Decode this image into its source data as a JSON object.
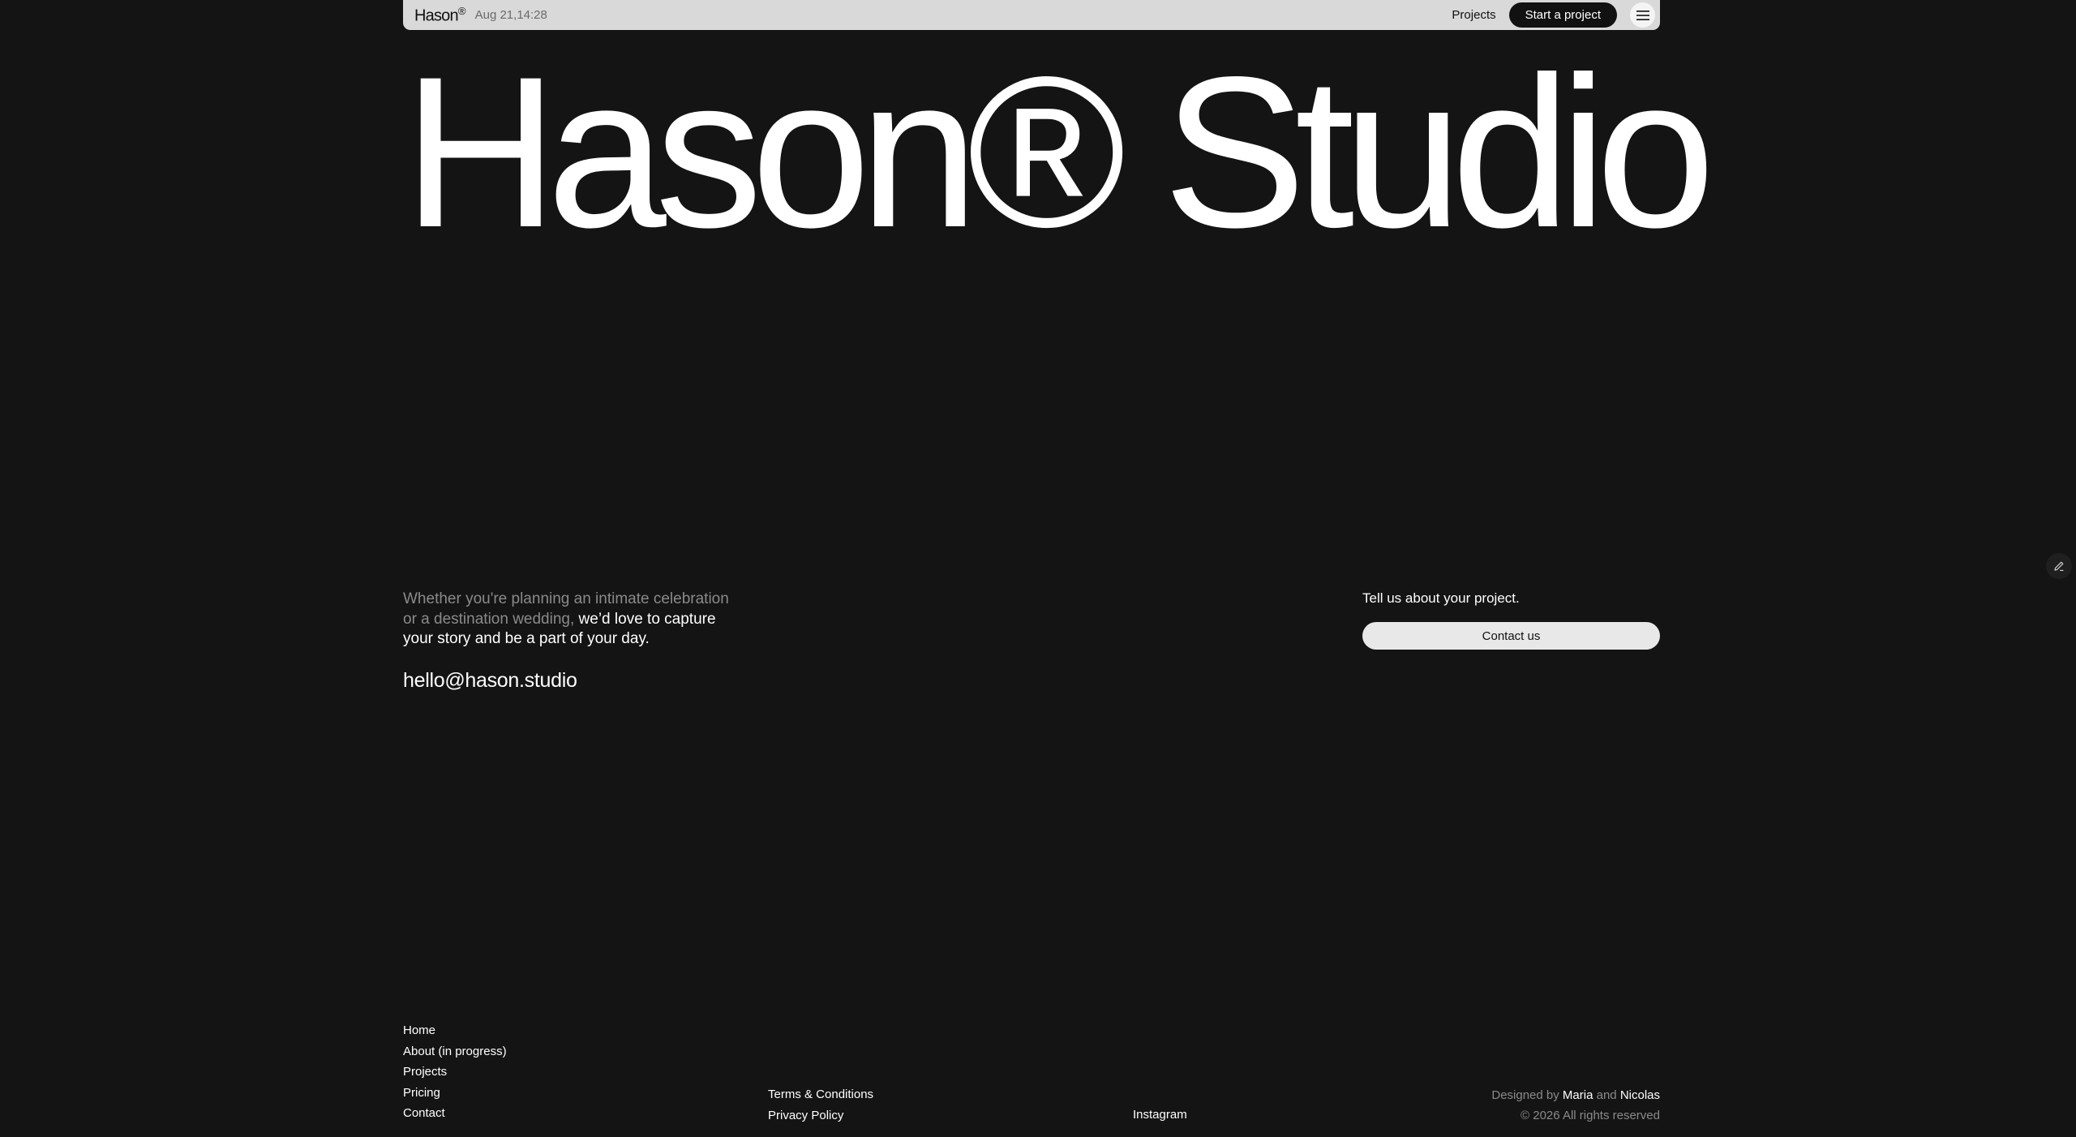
{
  "header": {
    "logo": "Hason",
    "logo_mark": "®",
    "datetime": "Aug 21,14:28",
    "projects_link": "Projects",
    "start_button": "Start a project",
    "menu_icon": "hamburger-menu-icon"
  },
  "hero": {
    "title": "Hason® Studio"
  },
  "intro": {
    "text_muted": "Whether you're planning an intimate celebration or a destination wedding,",
    "text_bright": "we’d love to capture your story and be a part of your day.",
    "email": "hello@hason.studio"
  },
  "contact": {
    "prompt": "Tell us about your project.",
    "button": "Contact us"
  },
  "edit_icon": "pencil-icon",
  "footer": {
    "nav": [
      "Home",
      "About (in progress)",
      "Projects",
      "Pricing",
      "Contact"
    ],
    "legal": [
      "Terms & Conditions",
      "Privacy Policy"
    ],
    "social": [
      "Instagram"
    ],
    "credits": {
      "designed_by": "Designed by",
      "name1": "Maria",
      "and": "and",
      "name2": "Nicolas",
      "copyright": "© 2026 All rights reserved"
    }
  },
  "colors": {
    "background": "#141414",
    "topbar": "#d9d9d9",
    "text": "#ffffff",
    "muted": "#8a8a8a"
  }
}
